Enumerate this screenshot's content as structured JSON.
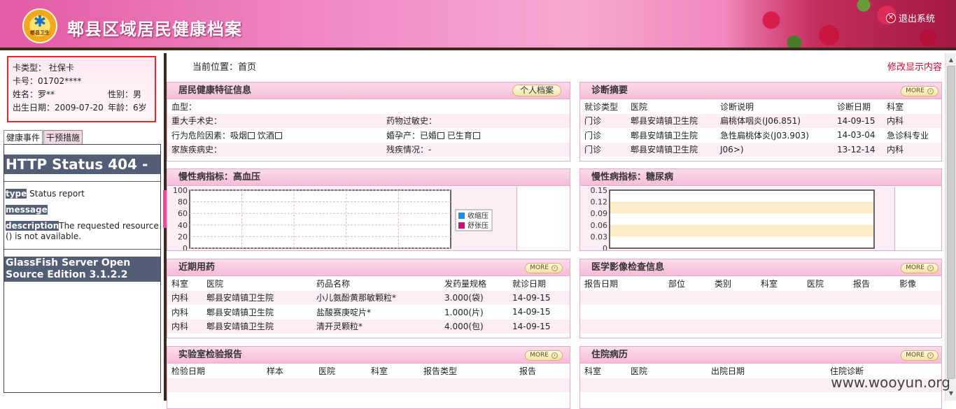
{
  "header": {
    "title": "郫县区域居民健康档案",
    "logo_text": "郫县卫生",
    "logout": "退出系统"
  },
  "card": {
    "card_type_label": "卡类型：",
    "card_type": "社保卡",
    "card_no_label": "卡号：",
    "card_no": "01702****",
    "name_label": "姓名：",
    "name": "罗**",
    "gender_label": "性别：",
    "gender": "男",
    "dob_label": "出生日期：",
    "dob": "2009-07-20",
    "age_label": "年龄：",
    "age": "6岁"
  },
  "tabs": [
    "健康事件",
    "干预措施"
  ],
  "error": {
    "title": "HTTP Status 404 -",
    "type_label": "type",
    "type_text": "Status report",
    "message_label": "message",
    "description_label": "description",
    "description_text": "The requested resource () is not available.",
    "server": "GlassFish Server Open Source Edition 3.1.2.2"
  },
  "breadcrumb": "当前位置：首页",
  "edit_link": "修改显示内容",
  "more_label": "MORE",
  "health": {
    "title": "居民健康特征信息",
    "button": "个人档案",
    "blood_type": "血型：",
    "surgery": "重大手术史：",
    "allergy": "药物过敏史：",
    "risk": "行为危险因素：吸烟",
    "drink": "饮酒",
    "pregnancy": "婚孕产：已婚",
    "birth": "已生育",
    "family": "家族疾病史：",
    "disability": "残疾情况：-"
  },
  "diagnosis": {
    "title": "诊断摘要",
    "headers": [
      "就诊类型",
      "医院",
      "诊断说明",
      "诊断日期",
      "科室"
    ],
    "rows": [
      [
        "门诊",
        "郫县安靖镇卫生院",
        "扁桃体咽炎(J06.851)",
        "14-09-15",
        "内科"
      ],
      [
        "门诊",
        "郫县安靖镇卫生院",
        "急性扁桃体炎(J03.903)",
        "14-03-04",
        "急诊科专业"
      ],
      [
        "门诊",
        "郫县安靖镇卫生院",
        "J06>)",
        "13-12-14",
        "内科"
      ]
    ]
  },
  "bp": {
    "title": "慢性病指标：高血压"
  },
  "dm": {
    "title": "慢性病指标：糖尿病"
  },
  "medication": {
    "title": "近期用药",
    "headers": [
      "科室",
      "医院",
      "药品名称",
      "发药量规格",
      "就诊日期"
    ],
    "rows": [
      [
        "内科",
        "郫县安靖镇卫生院",
        "小儿氨酚黄那敏颗粒*",
        "3.000(袋)",
        "14-09-15"
      ],
      [
        "内科",
        "郫县安靖镇卫生院",
        "盐酸赛庚啶片*",
        "1.000(片)",
        "14-09-15"
      ],
      [
        "内科",
        "郫县安靖镇卫生院",
        "清开灵颗粒*",
        "4.000(包)",
        "14-09-15"
      ]
    ]
  },
  "imaging": {
    "title": "医学影像检查信息",
    "headers": [
      "报告日期",
      "部位",
      "类别",
      "科室",
      "医院",
      "报告",
      "影像"
    ]
  },
  "lab": {
    "title": "实验室检验报告",
    "headers": [
      "检验日期",
      "样本",
      "医院",
      "科室",
      "报告类型",
      "报告"
    ]
  },
  "inpatient": {
    "title": "住院病历",
    "headers": [
      "科室",
      "医院",
      "出院日期",
      "住院诊断"
    ]
  },
  "watermark": "www.wooyun.org",
  "colors": {
    "systolic": "#1f8fe6",
    "diastolic": "#d0107a",
    "accent": "#e84c9c"
  },
  "chart_data": [
    {
      "type": "line",
      "ylim": [
        0,
        100
      ],
      "yticks": [
        0,
        20,
        40,
        60,
        80,
        100
      ],
      "series": [
        {
          "name": "收缩压",
          "values": []
        },
        {
          "name": "舒张压",
          "values": []
        }
      ]
    },
    {
      "type": "line",
      "ylim": [
        0,
        0.15
      ],
      "yticks": [
        0,
        0.03,
        0.06,
        0.09,
        0.12,
        0.15
      ],
      "series": []
    }
  ]
}
